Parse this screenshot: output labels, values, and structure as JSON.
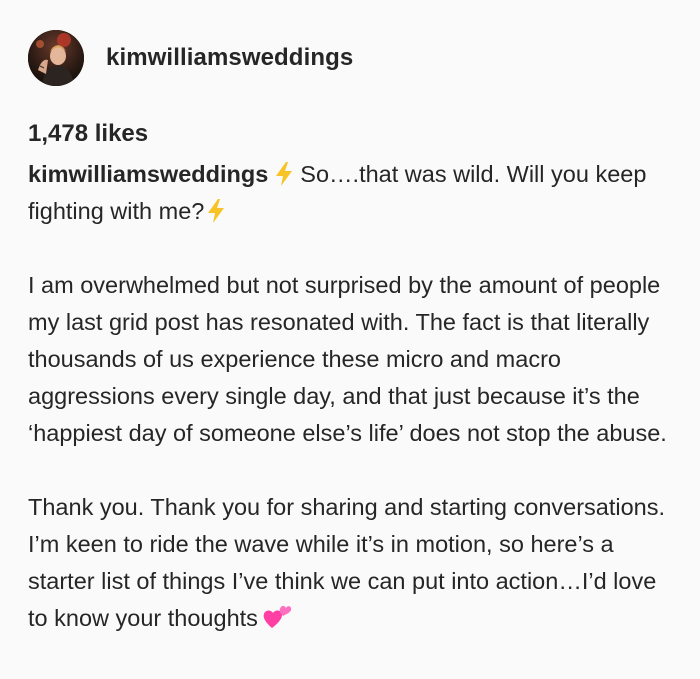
{
  "header": {
    "username": "kimwilliamsweddings",
    "avatar_icon": "profile-photo-avatar"
  },
  "likes": {
    "text": "1,478 likes"
  },
  "caption": {
    "username": "kimwilliamsweddings",
    "intro_a": "So….that was wild. Will you keep fighting with me?",
    "emoji_bolt": "lightning-bolt-icon",
    "paragraph_2": "I am overwhelmed but not surprised by the amount of people my last grid post has resonated with. The fact is that literally thousands of us experience these micro and macro aggressions every single day, and that just because it’s the ‘happiest day of someone else’s life’ does not stop the abuse.",
    "paragraph_3": "Thank you. Thank you for sharing and starting conversations. I’m keen to ride the wave while it’s in motion, so here’s a starter list of things I’ve think we can put into action…I’d love to know your thoughts",
    "emoji_heart": "two-hearts-icon"
  },
  "colors": {
    "text": "#262626",
    "background": "#fafafa",
    "bolt": "#f7c325",
    "heart": "#ff3fa4"
  }
}
